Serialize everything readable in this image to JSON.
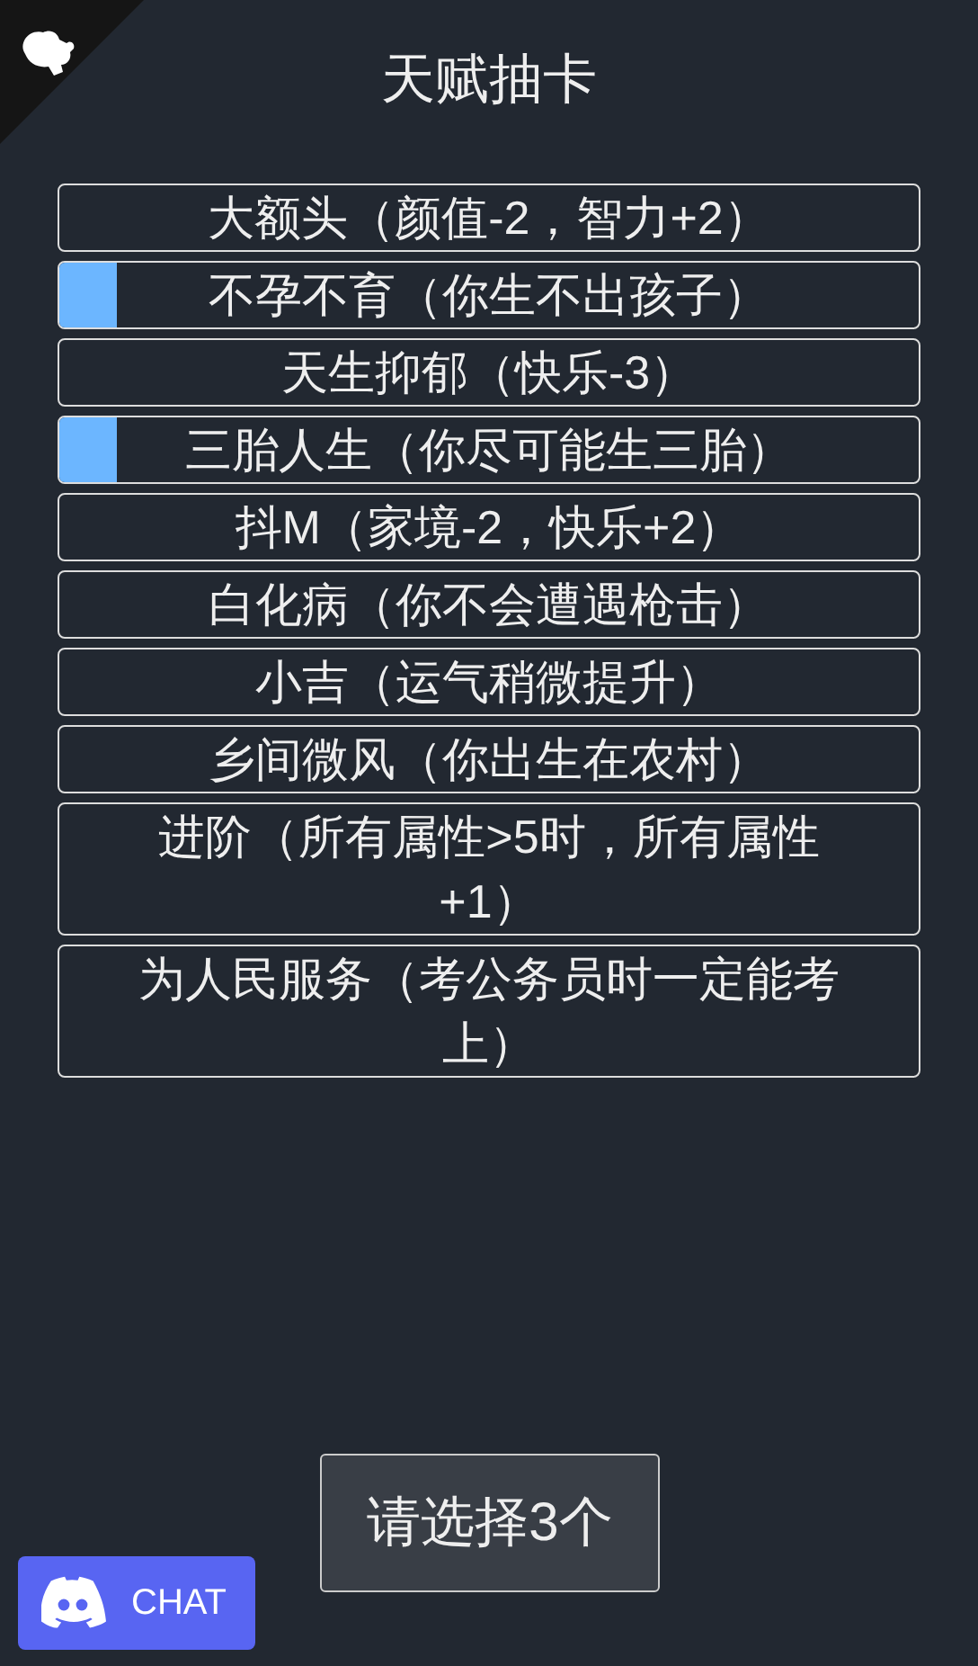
{
  "title": "天赋抽卡",
  "talents": [
    {
      "label": "大额头（颜值-2，智力+2）",
      "selected": false
    },
    {
      "label": "不孕不育（你生不出孩子）",
      "selected": true
    },
    {
      "label": "天生抑郁（快乐-3）",
      "selected": false
    },
    {
      "label": "三胎人生（你尽可能生三胎）",
      "selected": true
    },
    {
      "label": "抖M（家境-2，快乐+2）",
      "selected": false
    },
    {
      "label": "白化病（你不会遭遇枪击）",
      "selected": false
    },
    {
      "label": "小吉（运气稍微提升）",
      "selected": false
    },
    {
      "label": "乡间微风（你出生在农村）",
      "selected": false
    },
    {
      "label": "进阶（所有属性>5时，所有属性+1）",
      "selected": false
    },
    {
      "label": "为人民服务（考公务员时一定能考上）",
      "selected": false
    }
  ],
  "confirm_button": "请选择3个",
  "chat_button": "CHAT"
}
